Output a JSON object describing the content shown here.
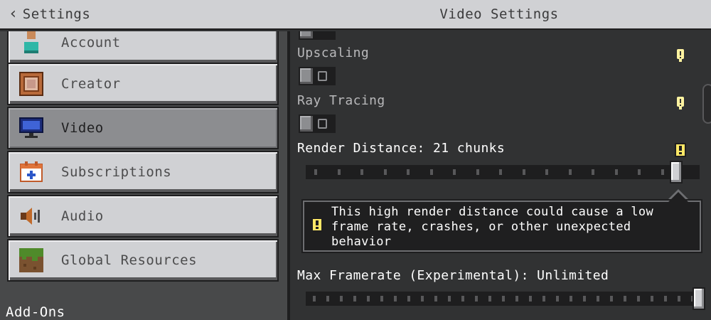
{
  "header": {
    "back_label": "Settings",
    "title": "Video Settings"
  },
  "sidebar": {
    "items": [
      {
        "label": "Account",
        "icon": "account-icon",
        "selected": false
      },
      {
        "label": "Creator",
        "icon": "creator-icon",
        "selected": false
      },
      {
        "label": "Video",
        "icon": "monitor-icon",
        "selected": true
      },
      {
        "label": "Subscriptions",
        "icon": "subscriptions-icon",
        "selected": false
      },
      {
        "label": "Audio",
        "icon": "speaker-icon",
        "selected": false
      },
      {
        "label": "Global Resources",
        "icon": "grass-block-icon",
        "selected": false
      }
    ],
    "section_label": "Add-Ons"
  },
  "settings": {
    "upscaling": {
      "label": "Upscaling",
      "state": "off"
    },
    "ray_tracing": {
      "label": "Ray Tracing",
      "state": "off"
    },
    "render_distance": {
      "label": "Render Distance: 21 chunks",
      "value": 21,
      "warning": "This high render distance could cause a low frame rate, crashes, or other unexpected behavior"
    },
    "max_framerate": {
      "label": "Max Framerate (Experimental): Unlimited"
    }
  },
  "colors": {
    "header_bg": "#d0d1d4",
    "panel_bg": "#313233",
    "sidebar_bg": "#48494a",
    "selected_item": "#8c8d90",
    "warning_yellow": "#ffe866"
  }
}
